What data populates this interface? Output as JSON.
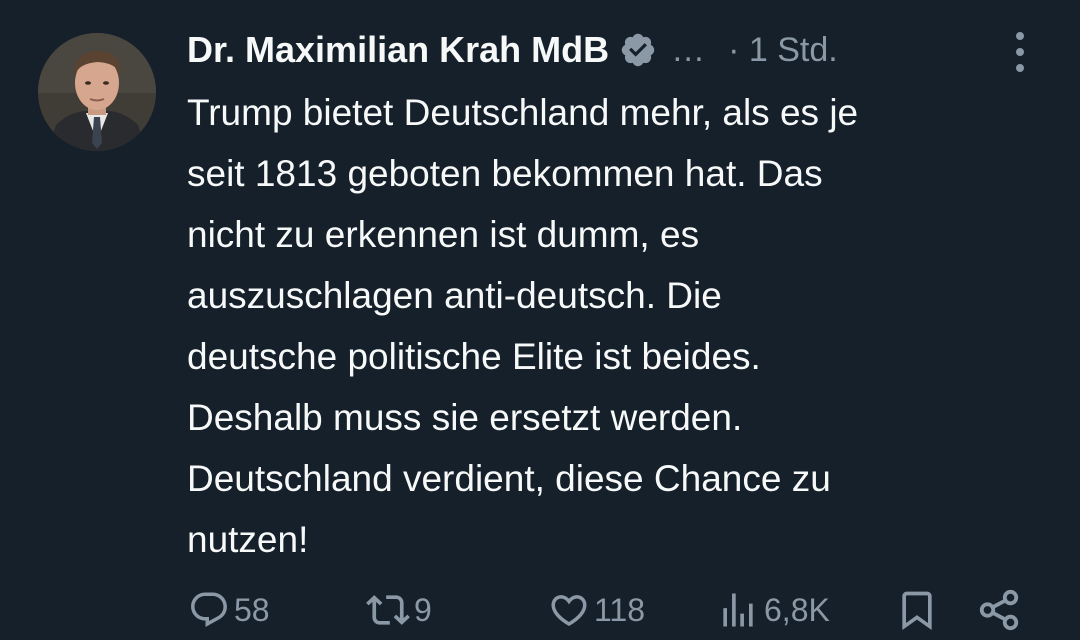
{
  "tweet": {
    "author_name": "Dr. Maximilian Krah MdB",
    "ellipsis": "…",
    "time": "· 1 Std.",
    "text_lines": [
      "Trump bietet Deutschland mehr, als es je",
      "seit 1813 geboten bekommen hat. Das",
      "nicht zu erkennen ist dumm, es",
      "auszuschlagen anti-deutsch. Die",
      "deutsche politische Elite ist beides.",
      "Deshalb muss sie ersetzt werden.",
      "Deutschland verdient, diese Chance zu",
      "nutzen!"
    ]
  },
  "actions": {
    "replies": "58",
    "reposts": "9",
    "likes": "118",
    "views": "6,8K"
  },
  "icons": [
    "avatar",
    "verified-badge-icon",
    "more-icon",
    "reply-icon",
    "repost-icon",
    "like-icon",
    "views-icon",
    "bookmark-icon",
    "share-icon"
  ],
  "colors": {
    "background": "#15202b",
    "text": "#f7f9f9",
    "secondary": "#8b98a5"
  }
}
